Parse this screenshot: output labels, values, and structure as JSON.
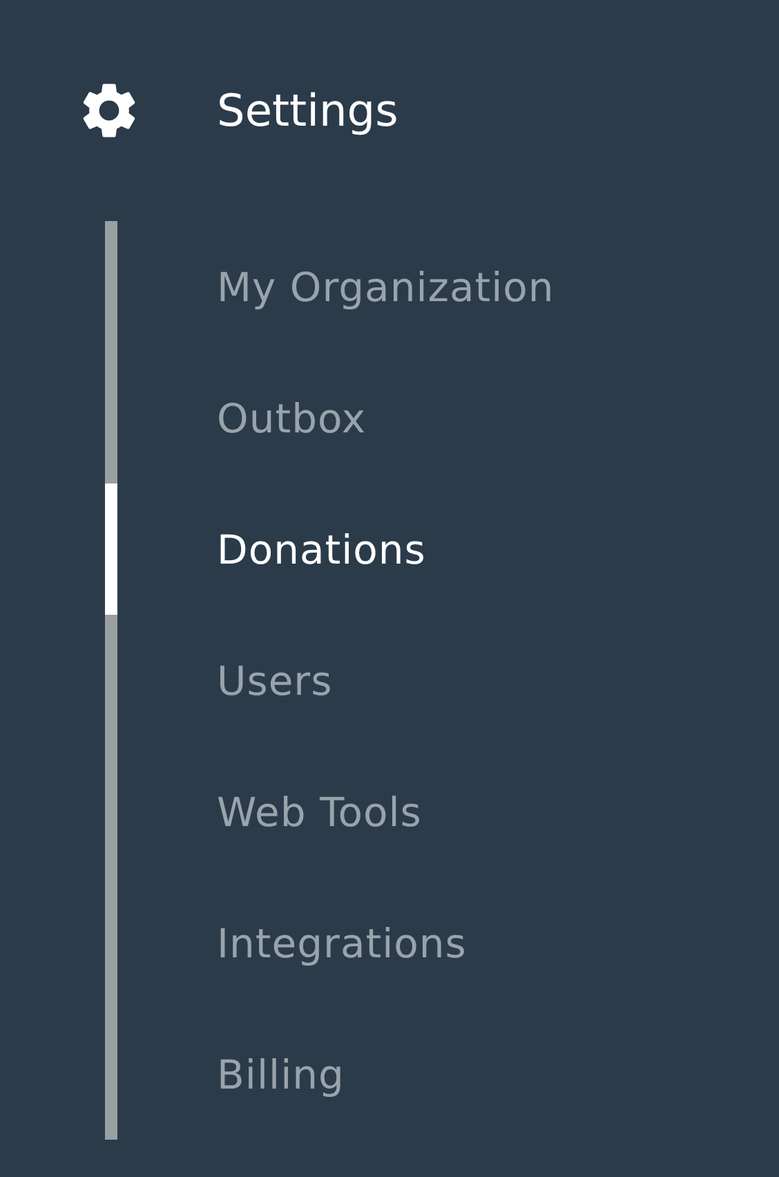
{
  "header": {
    "title": "Settings"
  },
  "menu": [
    {
      "label": "My Organization",
      "selected": false
    },
    {
      "label": "Outbox",
      "selected": false
    },
    {
      "label": "Donations",
      "selected": true
    },
    {
      "label": "Users",
      "selected": false
    },
    {
      "label": "Web Tools",
      "selected": false
    },
    {
      "label": "Integrations",
      "selected": false
    },
    {
      "label": "Billing",
      "selected": false
    }
  ]
}
